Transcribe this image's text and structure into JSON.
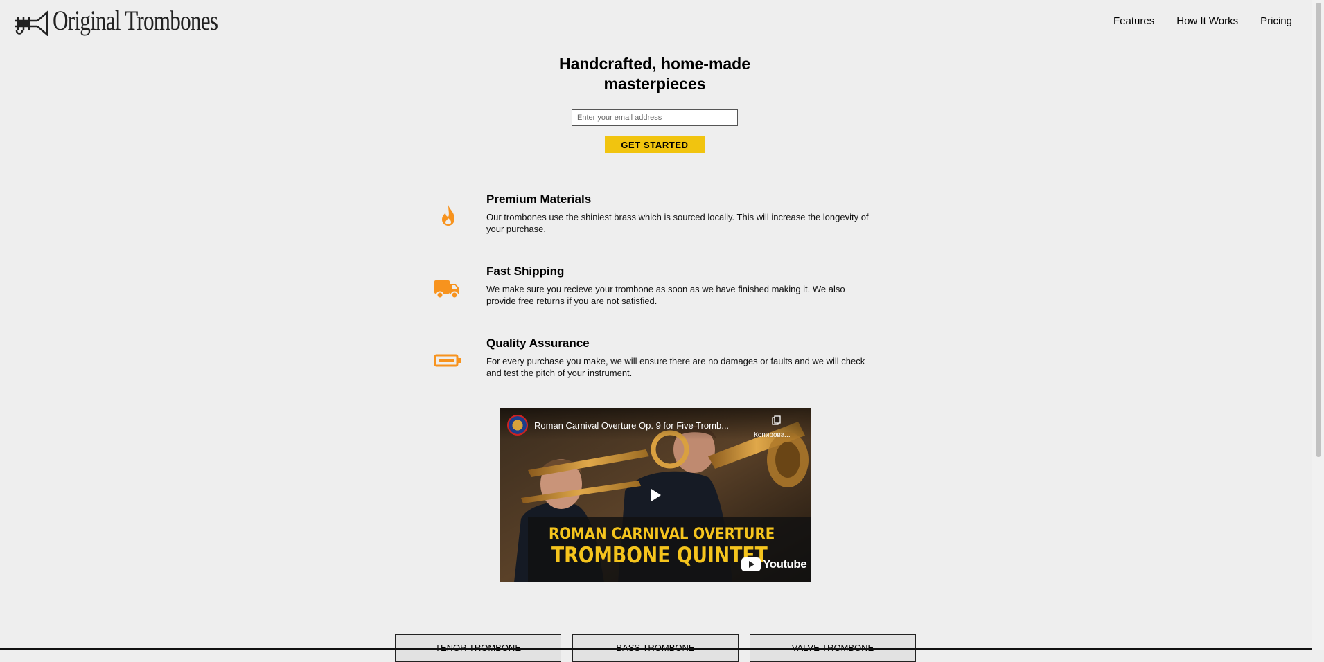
{
  "brand": {
    "logo_text": "Original Trombones",
    "logo_icon": "trombone-logo-icon"
  },
  "nav": {
    "items": [
      {
        "label": "Features"
      },
      {
        "label": "How It Works"
      },
      {
        "label": "Pricing"
      }
    ]
  },
  "hero": {
    "title": "Handcrafted, home-made masterpieces",
    "email_placeholder": "Enter your email address",
    "cta_label": "GET STARTED"
  },
  "features": [
    {
      "icon": "fire-icon",
      "title": "Premium Materials",
      "text": "Our trombones use the shiniest brass which is sourced locally. This will increase the longevity of your purchase."
    },
    {
      "icon": "truck-icon",
      "title": "Fast Shipping",
      "text": "We make sure you recieve your trombone as soon as we have finished making it. We also provide free returns if you are not satisfied."
    },
    {
      "icon": "battery-icon",
      "title": "Quality Assurance",
      "text": "For every purchase you make, we will ensure there are no damages or faults and we will check and test the pitch of your instrument."
    }
  ],
  "video": {
    "title": "Roman Carnival Overture Op. 9 for Five Tromb...",
    "copy_label": "Копирова...",
    "banner_line1": "ROMAN CARNIVAL OVERTURE",
    "banner_line2": "TROMBONE QUINTET",
    "youtube_label": "Youtube"
  },
  "tabs": [
    {
      "label": "TENOR TROMBONE"
    },
    {
      "label": "BASS TROMBONE"
    },
    {
      "label": "VALVE TROMBONE"
    }
  ],
  "colors": {
    "background": "#eeeeee",
    "accent": "#f1c40f",
    "icon_orange": "#f7931e"
  }
}
